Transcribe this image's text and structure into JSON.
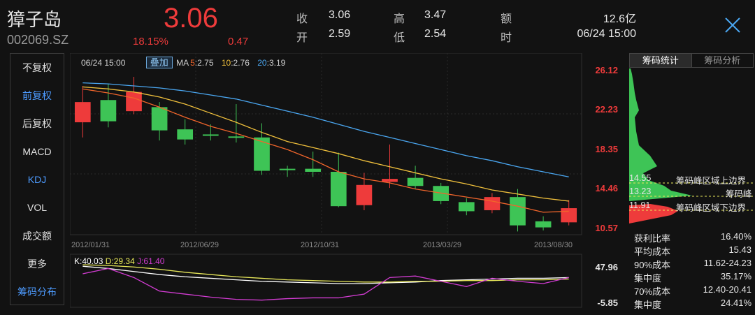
{
  "header": {
    "name": "獐子岛",
    "code": "002069.SZ",
    "price": "3.06",
    "change_pct": "18.15%",
    "change": "0.47",
    "stats": [
      {
        "label": "收",
        "value": "3.06"
      },
      {
        "label": "高",
        "value": "3.47"
      },
      {
        "label": "额",
        "value": "12.6亿"
      },
      {
        "label": "开",
        "value": "2.59"
      },
      {
        "label": "低",
        "value": "2.54"
      },
      {
        "label": "时",
        "value": "06/24 15:00"
      }
    ]
  },
  "left_menu": [
    {
      "label": "不复权",
      "active": false
    },
    {
      "label": "前复权",
      "active": true
    },
    {
      "label": "后复权",
      "active": false
    },
    {
      "label": "MACD",
      "active": false
    },
    {
      "label": "KDJ",
      "active": true
    },
    {
      "label": "VOL",
      "active": false
    },
    {
      "label": "成交额",
      "active": false
    },
    {
      "label": "更多",
      "active": false
    },
    {
      "label": "筹码分布",
      "active": true
    }
  ],
  "chart_toolbar": {
    "date": "06/24 15:00",
    "overlay_label": "叠加",
    "ma": [
      {
        "prefix": "MA",
        "period": "5",
        "value": ":2.75",
        "color": "#f0652b"
      },
      {
        "prefix": "",
        "period": "10",
        "value": ":2.76",
        "color": "#f0c03c"
      },
      {
        "prefix": "",
        "period": "20",
        "value": ":3.19",
        "color": "#4aa6f0"
      }
    ]
  },
  "kdj_toolbar": {
    "k": "K:40.03",
    "d": "D:29.34",
    "j": "J:61.40"
  },
  "colors": {
    "up": "#ee3b3b",
    "down": "#3ec456",
    "ma5": "#f0652b",
    "ma10": "#f0c03c",
    "ma20": "#4aa6f0",
    "k": "#ffffff",
    "d": "#e8e85a",
    "j": "#d23cd2",
    "accent": "#4d9bff"
  },
  "chart_data": {
    "type": "candlestick",
    "y_axis_labels": [
      "26.12",
      "22.23",
      "18.35",
      "14.46",
      "10.57"
    ],
    "ylim": [
      10.57,
      26.12
    ],
    "x_axis_labels": [
      "2012/01/31",
      "2012/06/29",
      "2012/10/31",
      "2013/03/29",
      "2013/08/30"
    ],
    "candles": [
      {
        "open": 21.0,
        "close": 23.0,
        "high": 24.6,
        "low": 19.5
      },
      {
        "open": 23.2,
        "close": 21.1,
        "high": 24.8,
        "low": 20.5
      },
      {
        "open": 22.1,
        "close": 24.0,
        "high": 25.5,
        "low": 21.8
      },
      {
        "open": 22.5,
        "close": 20.2,
        "high": 23.0,
        "low": 19.2
      },
      {
        "open": 20.3,
        "close": 19.3,
        "high": 21.3,
        "low": 18.8
      },
      {
        "open": 19.8,
        "close": 19.7,
        "high": 20.8,
        "low": 19.2
      },
      {
        "open": 19.6,
        "close": 19.5,
        "high": 22.8,
        "low": 19.0
      },
      {
        "open": 19.5,
        "close": 16.2,
        "high": 20.9,
        "low": 15.8
      },
      {
        "open": 16.4,
        "close": 16.3,
        "high": 16.7,
        "low": 15.6
      },
      {
        "open": 16.4,
        "close": 16.1,
        "high": 18.1,
        "low": 15.6
      },
      {
        "open": 16.1,
        "close": 12.7,
        "high": 18.0,
        "low": 12.6
      },
      {
        "open": 12.8,
        "close": 14.8,
        "high": 16.0,
        "low": 12.3
      },
      {
        "open": 15.1,
        "close": 15.4,
        "high": 18.8,
        "low": 14.5
      },
      {
        "open": 15.5,
        "close": 14.7,
        "high": 16.7,
        "low": 14.4
      },
      {
        "open": 14.7,
        "close": 13.2,
        "high": 15.0,
        "low": 12.9
      },
      {
        "open": 13.1,
        "close": 12.2,
        "high": 13.5,
        "low": 11.8
      },
      {
        "open": 12.3,
        "close": 13.6,
        "high": 14.0,
        "low": 12.0
      },
      {
        "open": 13.6,
        "close": 10.8,
        "high": 14.4,
        "low": 10.2
      },
      {
        "open": 11.2,
        "close": 10.6,
        "high": 11.7,
        "low": 10.3
      },
      {
        "open": 11.1,
        "close": 12.5,
        "high": 13.3,
        "low": 10.8
      }
    ],
    "ma5": [
      24.3,
      23.9,
      23.4,
      22.5,
      21.5,
      20.6,
      19.9,
      19.1,
      18.3,
      17.3,
      16.1,
      15.4,
      15.0,
      14.4,
      14.0,
      13.6,
      13.2,
      12.7,
      12.1,
      12.2
    ],
    "ma10": [
      24.5,
      24.3,
      24.0,
      23.5,
      22.8,
      21.9,
      21.0,
      20.0,
      19.1,
      18.5,
      17.9,
      17.2,
      16.6,
      16.0,
      15.4,
      14.9,
      14.3,
      13.9,
      13.5,
      13.2
    ],
    "ma20": [
      24.9,
      24.8,
      24.6,
      24.4,
      24.1,
      23.7,
      23.3,
      22.7,
      22.1,
      21.5,
      20.8,
      20.1,
      19.5,
      18.9,
      18.3,
      17.7,
      17.2,
      16.6,
      16.1,
      15.6
    ],
    "kdj_axis_labels": [
      "47.96",
      "-5.85"
    ],
    "kdj_ylim": [
      -5.85,
      47.96
    ],
    "k": [
      45,
      42,
      38,
      34,
      31,
      29,
      27,
      25,
      24,
      23,
      22,
      22,
      23,
      24,
      26,
      27,
      28,
      29,
      29,
      30
    ],
    "d": [
      47,
      46,
      44,
      41,
      37,
      34,
      31,
      29,
      27,
      26,
      25,
      24,
      24,
      25,
      25,
      26,
      26,
      27,
      27,
      28
    ],
    "j": [
      35,
      42,
      30,
      12,
      8,
      4,
      1,
      0,
      2,
      3,
      3,
      8,
      30,
      32,
      25,
      18,
      29,
      25,
      22,
      30
    ]
  },
  "chip_distribution": {
    "tabs": [
      {
        "label": "筹码统计",
        "active": true
      },
      {
        "label": "筹码分析",
        "active": false
      }
    ],
    "markers": [
      {
        "value": "14.55",
        "label": "筹码峰区域上边界"
      },
      {
        "value": "13.23",
        "label": "筹码峰"
      },
      {
        "value": "11.91",
        "label": "筹码峰区域下边界"
      }
    ],
    "stats": [
      {
        "label": "获利比率",
        "value": "16.40%"
      },
      {
        "label": "平均成本",
        "value": "15.43"
      },
      {
        "label": "90%成本",
        "value": "11.62-24.23"
      },
      {
        "label": "集中度",
        "value": "35.17%"
      },
      {
        "label": "70%成本",
        "value": "12.40-20.41"
      },
      {
        "label": "集中度",
        "value": "24.41%"
      }
    ]
  }
}
